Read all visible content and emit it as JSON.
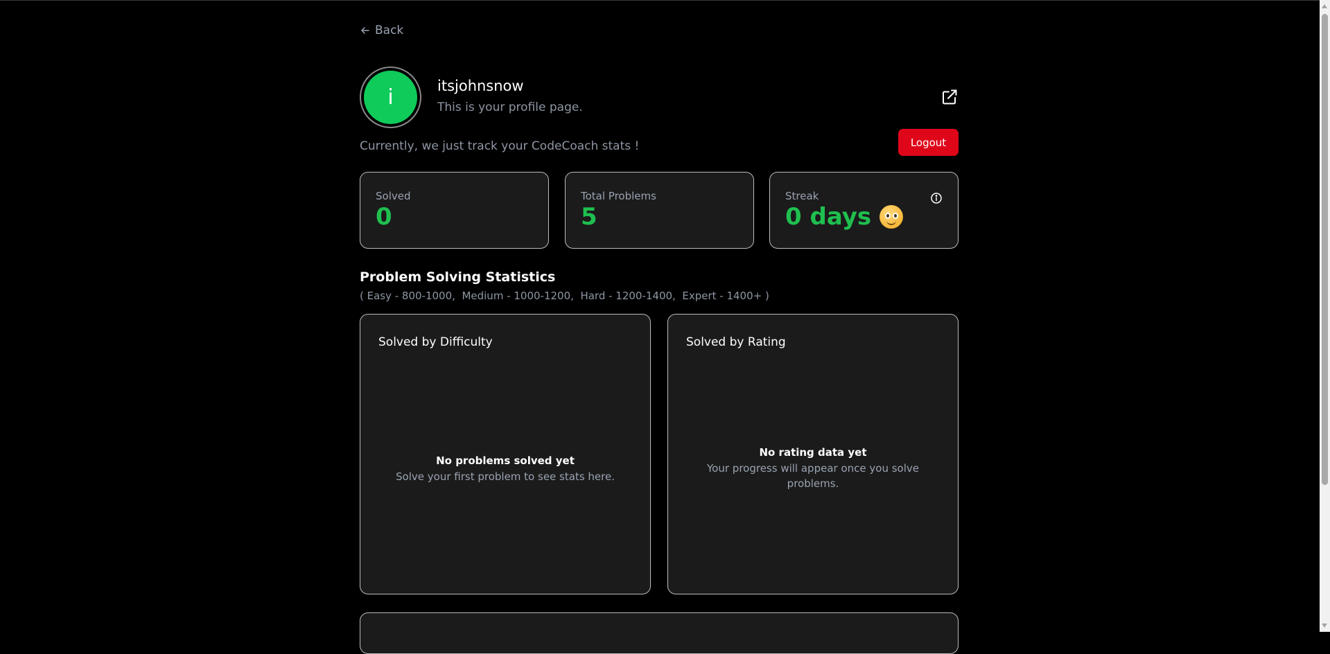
{
  "nav": {
    "back_label": "Back"
  },
  "profile": {
    "avatar_letter": "i",
    "username": "itsjohnsnow",
    "subtitle": "This is your profile page.",
    "note": "Currently, we just track your CodeCoach stats !",
    "logout_label": "Logout",
    "avatar_color": "#0fcb5a"
  },
  "stats": [
    {
      "label": "Solved",
      "value": "0"
    },
    {
      "label": "Total Problems",
      "value": "5"
    },
    {
      "label": "Streak",
      "value": "0 days"
    }
  ],
  "statistics": {
    "title": "Problem Solving Statistics",
    "legend": "( Easy - 800-1000,  Medium - 1000-1200,  Hard - 1200-1400,  Expert - 1400+ )",
    "difficulty": {
      "title": "Solved by Difficulty",
      "empty_title": "No problems solved yet",
      "empty_msg": "Solve your first problem to see stats here."
    },
    "rating": {
      "title": "Solved by Rating",
      "empty_title": "No rating data yet",
      "empty_msg": "Your progress will appear once you solve problems."
    }
  },
  "colors": {
    "accent_green": "#1fbf4f",
    "logout_red": "#e0061a",
    "card_bg": "#1b1b1b"
  },
  "icons": [
    "arrow-left-icon",
    "external-link-icon",
    "info-icon",
    "smiley-emoji-icon"
  ]
}
